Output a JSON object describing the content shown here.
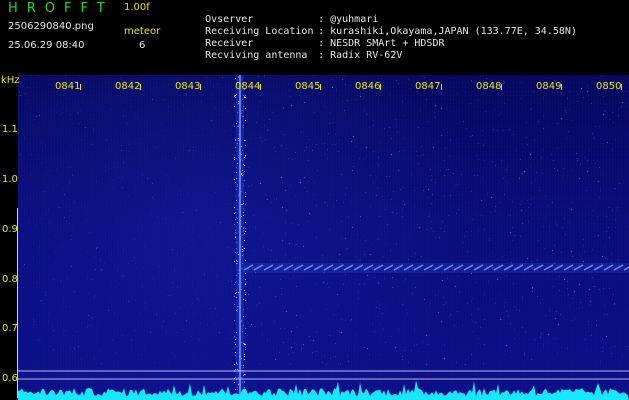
{
  "header": {
    "app_name": "HROFFT",
    "version": "1.00f",
    "file_name": "2506290840.png",
    "date_time": "25.06.29 08:40",
    "meteor_label": "meteor",
    "meteor_count": "6",
    "info": [
      {
        "key": "Ovserver",
        "sep": ":",
        "value": "@yuhmari"
      },
      {
        "key": "Receiving Location",
        "sep": ":",
        "value": "kurashiki,Okayama,JAPAN (133.77E, 34.58N)"
      },
      {
        "key": "Receiver",
        "sep": ":",
        "value": "NESDR SMArt + HDSDR"
      },
      {
        "key": "Recviving antenna",
        "sep": ":",
        "value": "Radix RV-62V"
      }
    ]
  },
  "axis": {
    "unit": "kHz",
    "y_labels": [
      "1.1",
      "1.0",
      "0.9",
      "0.8",
      "0.7",
      "0.6"
    ],
    "time_labels": [
      "0841",
      "0842",
      "0843",
      "0844",
      "0845",
      "0846",
      "0847",
      "0848",
      "0849",
      "0850"
    ]
  },
  "colors": {
    "header_green": "#22dd22",
    "label_yellow": "#e8e800",
    "info_white": "#e6e6e6",
    "spectrum_base": "#0a0c78",
    "noise_floor": "#19e6ff"
  },
  "icons": {
    "echo": "meteor-echo-trace",
    "carrier": "carrier-trace"
  }
}
